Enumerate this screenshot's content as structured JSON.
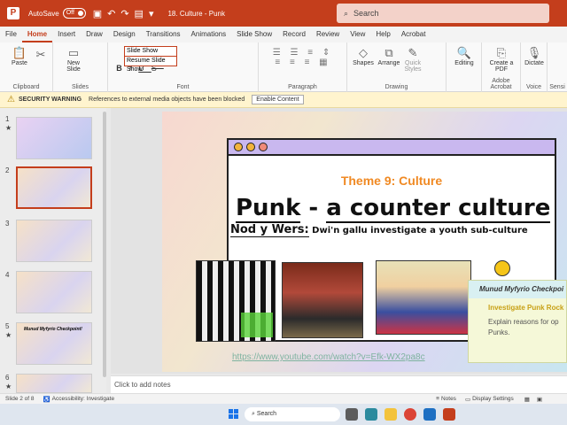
{
  "titlebar": {
    "app_icon": "P",
    "autosave_label": "AutoSave",
    "autosave_state": "Off",
    "quick_access": [
      "save-icon",
      "undo-icon",
      "redo-icon",
      "slideshow-icon",
      "customize-icon"
    ],
    "doc_title": "18. Culture - Punk",
    "search_placeholder": "Search"
  },
  "tabs": [
    "File",
    "Home",
    "Insert",
    "Draw",
    "Design",
    "Transitions",
    "Animations",
    "Slide Show",
    "Record",
    "Review",
    "View",
    "Help",
    "Acrobat"
  ],
  "ribbon": {
    "clipboard": {
      "paste": "Paste",
      "label": "Clipboard"
    },
    "slides": {
      "new_slide": "New Slide",
      "label": "Slides"
    },
    "font": {
      "box_value": "Slide Show",
      "menu_item": "Resume Slide Show",
      "bold": "B",
      "italic": "I",
      "underline": "U",
      "strike": "S",
      "label": "Font"
    },
    "paragraph": {
      "label": "Paragraph"
    },
    "drawing": {
      "shapes": "Shapes",
      "arrange": "Arrange",
      "quick_styles": "Quick Styles",
      "label": "Drawing"
    },
    "editing": {
      "label": "Editing"
    },
    "acrobat": {
      "create_pdf": "Create a PDF",
      "label": "Adobe Acrobat"
    },
    "voice": {
      "dictate": "Dictate",
      "label": "Voice"
    },
    "sensitivity": {
      "label": "Sensi"
    }
  },
  "security": {
    "title": "SECURITY WARNING",
    "message": "References to external media objects have been blocked",
    "button": "Enable Content"
  },
  "thumbnails": [
    {
      "num": "1",
      "starred": "★"
    },
    {
      "num": "2",
      "starred": ""
    },
    {
      "num": "3",
      "starred": ""
    },
    {
      "num": "4",
      "starred": ""
    },
    {
      "num": "5",
      "starred": "★"
    },
    {
      "num": "6",
      "starred": "★"
    }
  ],
  "thumb_texts": {
    "t5": "Munud Myfyrio Checkpoint!"
  },
  "slide": {
    "theme": "Theme 9: Culture",
    "title_a": "Punk",
    "title_b": " -  ",
    "title_c": "a counter culture",
    "sub_label": "Nod y Wers:",
    "sub_text": " Dwi'n gallu investigate a youth sub-culture",
    "url": "https://www.youtube.com/watch?v=Efk-WX2pa8c",
    "checkpoint_title": "Munud Myfyrio Checkpoi",
    "checkpoint_yellow": "Investigate Punk Rock",
    "checkpoint_text": "Explain reasons for op Punks."
  },
  "notes_placeholder": "Click to add notes",
  "status": {
    "slide_of": "Slide 2 of 8",
    "accessibility": "Accessibility: Investigate",
    "notes": "Notes",
    "display": "Display Settings"
  },
  "taskbar": {
    "search": "Search"
  },
  "colors": {
    "accent": "#c43e1c",
    "theme_orange": "#f08a24",
    "window_bar": "#c9b8ef"
  }
}
